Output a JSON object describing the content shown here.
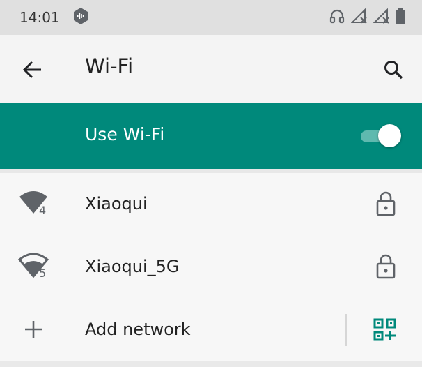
{
  "status_bar": {
    "time": "14:01",
    "icons": [
      "app-notification-icon",
      "headset-icon",
      "signal-no-service-icon",
      "signal-no-service-icon",
      "battery-icon"
    ]
  },
  "app_bar": {
    "title": "Wi-Fi",
    "back_icon": "back-arrow-icon",
    "search_icon": "search-icon"
  },
  "use_wifi": {
    "label": "Use Wi-Fi",
    "enabled": true
  },
  "networks": [
    {
      "name": "Xiaoqui",
      "signal_icon": "wifi-4-icon",
      "badge": "4",
      "locked": true
    },
    {
      "name": "Xiaoqui_5G",
      "signal_icon": "wifi-5-icon",
      "badge": "5",
      "locked": true
    }
  ],
  "add_network": {
    "label": "Add network",
    "icon": "plus-icon",
    "qr_icon": "qr-code-scanner-icon"
  },
  "colors": {
    "accent": "#00897b",
    "icon": "#5f6368",
    "background": "#f7f7f7"
  }
}
